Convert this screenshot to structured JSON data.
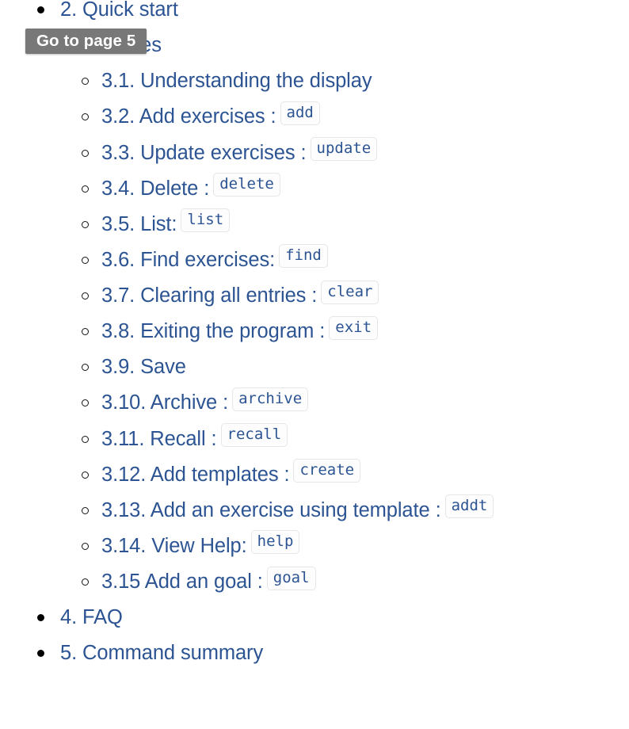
{
  "tooltip": {
    "label": "Go to page 5"
  },
  "toc": {
    "items": [
      {
        "level": 1,
        "bullet": "disc-bullet",
        "label": "2. Quick start",
        "code": ""
      },
      {
        "level": 1,
        "bullet": "disc-bullet",
        "label": "3. Features",
        "code": ""
      },
      {
        "level": 2,
        "bullet": "circle-bullet",
        "label": "3.1. Understanding the display",
        "code": ""
      },
      {
        "level": 2,
        "bullet": "circle-bullet",
        "label": "3.2. Add exercises :",
        "code": "add"
      },
      {
        "level": 2,
        "bullet": "circle-bullet",
        "label": "3.3. Update exercises :",
        "code": "update"
      },
      {
        "level": 2,
        "bullet": "circle-bullet",
        "label": "3.4. Delete :",
        "code": "delete"
      },
      {
        "level": 2,
        "bullet": "circle-bullet",
        "label": "3.5. List:",
        "code": "list"
      },
      {
        "level": 2,
        "bullet": "circle-bullet",
        "label": "3.6. Find exercises:",
        "code": "find"
      },
      {
        "level": 2,
        "bullet": "circle-bullet",
        "label": "3.7. Clearing all entries :",
        "code": "clear"
      },
      {
        "level": 2,
        "bullet": "circle-bullet",
        "label": "3.8. Exiting the program :",
        "code": "exit"
      },
      {
        "level": 2,
        "bullet": "circle-bullet",
        "label": "3.9. Save",
        "code": ""
      },
      {
        "level": 2,
        "bullet": "circle-bullet",
        "label": "3.10. Archive :",
        "code": "archive"
      },
      {
        "level": 2,
        "bullet": "circle-bullet",
        "label": "3.11. Recall :",
        "code": "recall"
      },
      {
        "level": 2,
        "bullet": "circle-bullet",
        "label": "3.12. Add templates :",
        "code": "create"
      },
      {
        "level": 2,
        "bullet": "circle-bullet",
        "label": "3.13. Add an exercise using template :",
        "code": "addt"
      },
      {
        "level": 2,
        "bullet": "circle-bullet",
        "label": "3.14. View Help:",
        "code": "help"
      },
      {
        "level": 2,
        "bullet": "circle-bullet",
        "label": "3.15 Add an goal :",
        "code": "goal"
      },
      {
        "level": 1,
        "bullet": "disc-bullet",
        "label": "4. FAQ",
        "code": ""
      },
      {
        "level": 1,
        "bullet": "disc-bullet",
        "label": "5. Command summary",
        "code": ""
      }
    ]
  },
  "colors": {
    "link": "#2c5493",
    "tooltip_background": "#787878",
    "tooltip_text": "#ffffff",
    "code_border": "#e6e6e6",
    "page_background": "#ffffff"
  }
}
